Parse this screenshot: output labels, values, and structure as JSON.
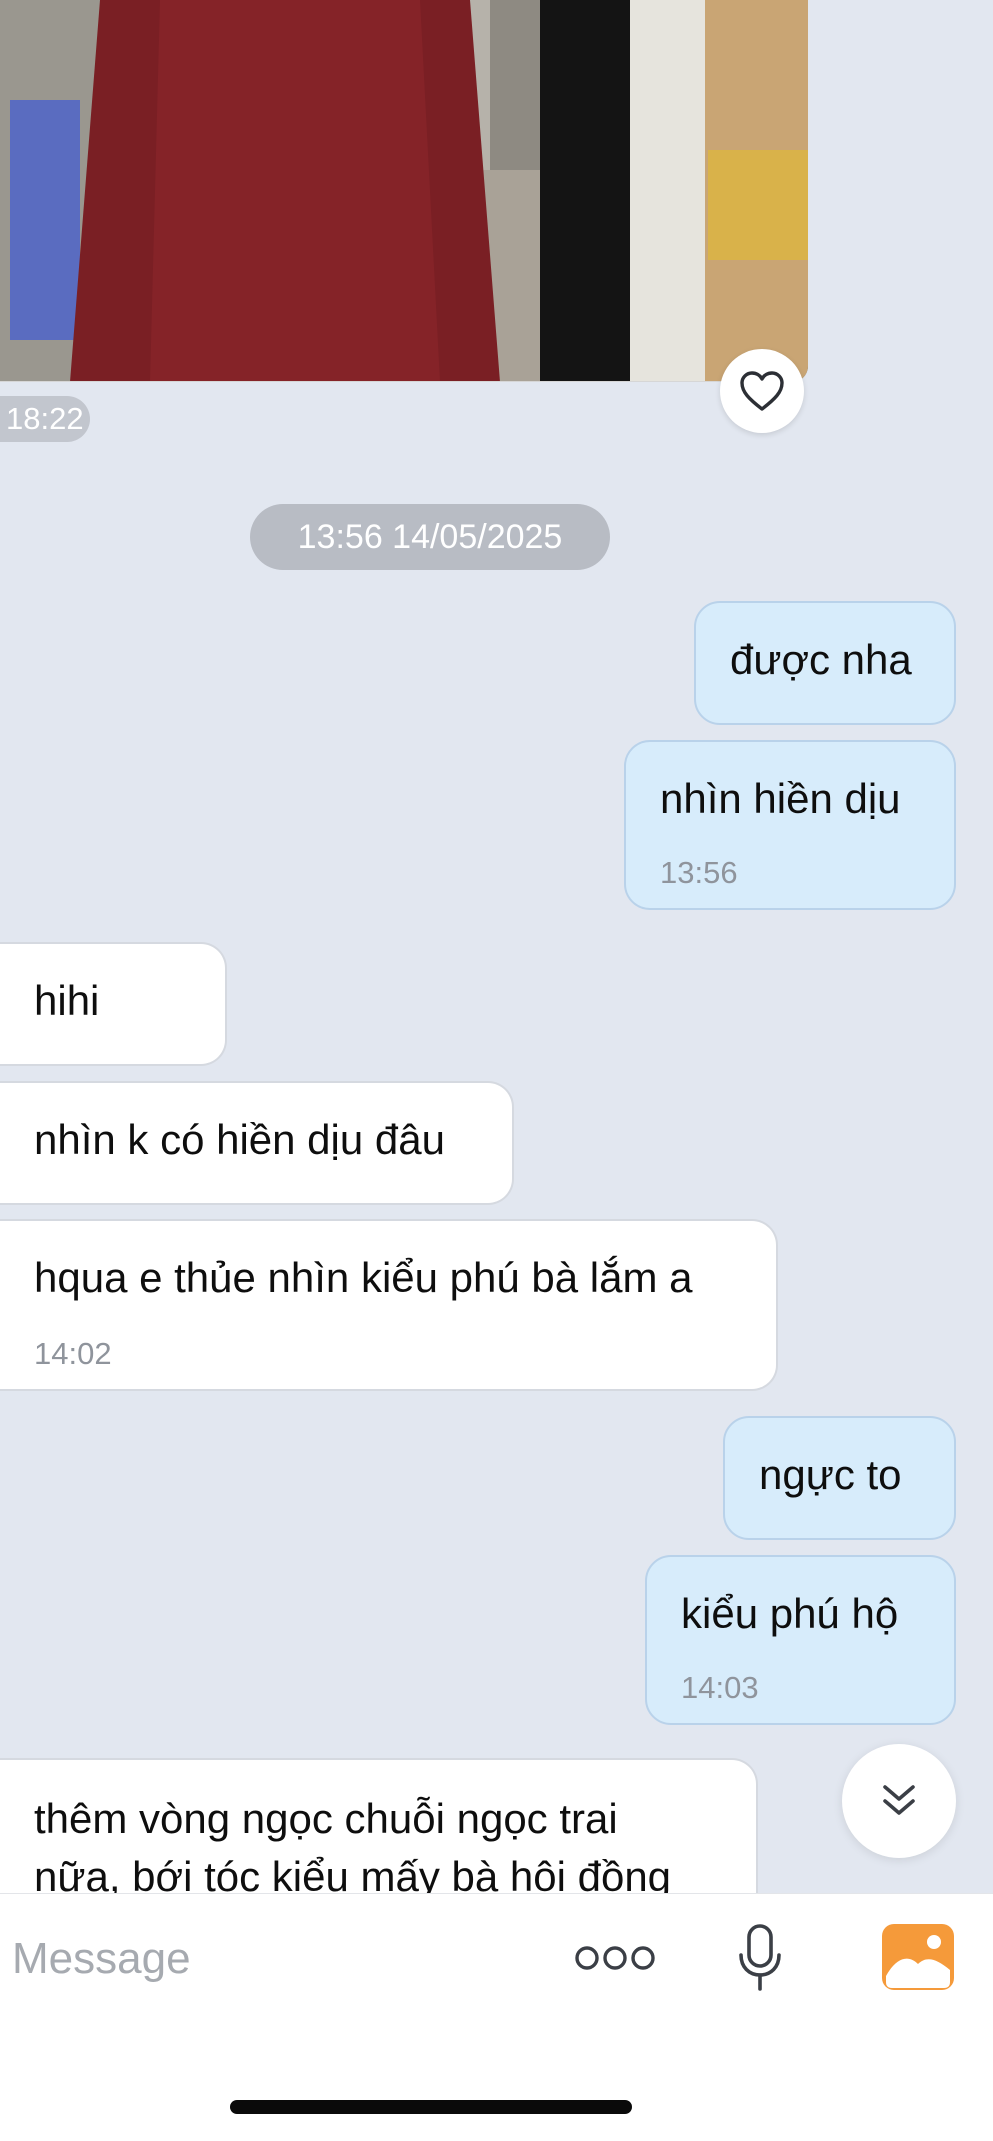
{
  "photo_message": {
    "time": "18:22",
    "like_icon": "heart-outline-icon"
  },
  "date_separator": "13:56 14/05/2025",
  "messages": [
    {
      "side": "sent",
      "text": "được nha"
    },
    {
      "side": "sent",
      "text": "nhìn hiền dịu",
      "time": "13:56"
    },
    {
      "side": "received",
      "text": "hihi"
    },
    {
      "side": "received",
      "text": "nhìn k có hiền dịu đâu"
    },
    {
      "side": "received",
      "text": "hqua e thủe nhìn kiểu phú bà lắm a",
      "time": "14:02"
    },
    {
      "side": "sent",
      "text": "ngực to"
    },
    {
      "side": "sent",
      "text": "kiểu phú hộ",
      "time": "14:03"
    },
    {
      "side": "received",
      "text": "thêm vòng ngọc chuỗi ngọc trai",
      "text_line2": "nữa, bới tóc kiểu mấy bà hội đồng"
    }
  ],
  "scroll_button_icon": "double-chevron-down-icon",
  "composer": {
    "placeholder": "Message",
    "more_icon": "more-dots-icon",
    "mic_icon": "microphone-icon",
    "gallery_icon": "photo-gallery-icon",
    "accent_color": "#f59a3a"
  },
  "colors": {
    "background": "#e2e7f0",
    "sent_bubble": "#d7ecfb",
    "received_bubble": "#ffffff"
  }
}
